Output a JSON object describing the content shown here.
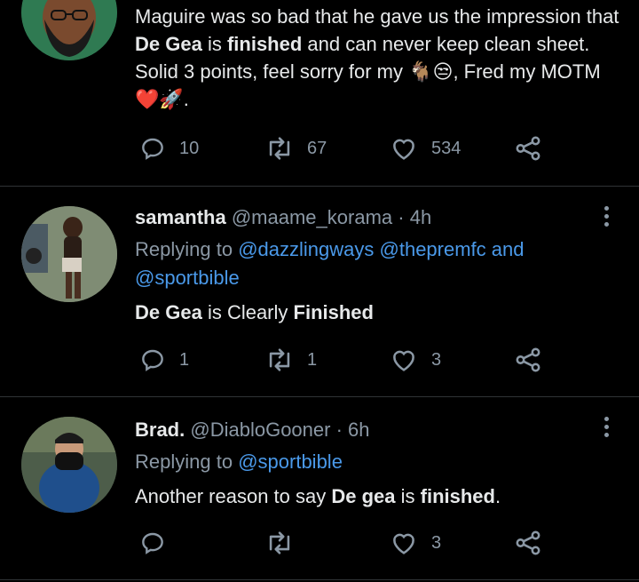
{
  "tweets": [
    {
      "text_parts": [
        {
          "t": "Maguire was so bad that he gave us the impression that ",
          "b": false
        },
        {
          "t": "De Gea",
          "b": true
        },
        {
          "t": " is ",
          "b": false
        },
        {
          "t": "finished",
          "b": true
        },
        {
          "t": " and can never keep clean sheet. Solid 3 points, feel sorry for my 🐐😒, Fred my MOTM❤️🚀.",
          "b": false
        }
      ],
      "actions": {
        "reply": "10",
        "retweet": "67",
        "like": "534"
      }
    },
    {
      "name": "samantha",
      "handle": "@maame_korama",
      "sep": "·",
      "time": "4h",
      "replying_prefix": "Replying to",
      "mentions": [
        "@dazzlingways",
        "@thepremfc",
        "@sportbible"
      ],
      "and_word": "and",
      "text_parts": [
        {
          "t": "De Gea",
          "b": true
        },
        {
          "t": " is Clearly ",
          "b": false
        },
        {
          "t": "Finished",
          "b": true
        }
      ],
      "actions": {
        "reply": "1",
        "retweet": "1",
        "like": "3"
      }
    },
    {
      "name": "Brad.",
      "handle": "@DiabloGooner",
      "sep": "·",
      "time": "6h",
      "replying_prefix": "Replying to",
      "mentions": [
        "@sportbible"
      ],
      "text_parts": [
        {
          "t": "Another reason to say ",
          "b": false
        },
        {
          "t": "De gea",
          "b": true
        },
        {
          "t": " is ",
          "b": false
        },
        {
          "t": "finished",
          "b": true
        },
        {
          "t": ".",
          "b": false
        }
      ],
      "actions": {
        "reply": "",
        "retweet": "",
        "like": "3"
      }
    }
  ],
  "icons": {
    "reply": "reply-icon",
    "retweet": "retweet-icon",
    "like": "heart-icon",
    "share": "share-icon",
    "more": "more-options-icon"
  },
  "colors": {
    "background": "#000000",
    "text": "#e7e9ea",
    "muted": "#8b98a5",
    "link": "#4a99e9",
    "divider": "#2f3336"
  }
}
